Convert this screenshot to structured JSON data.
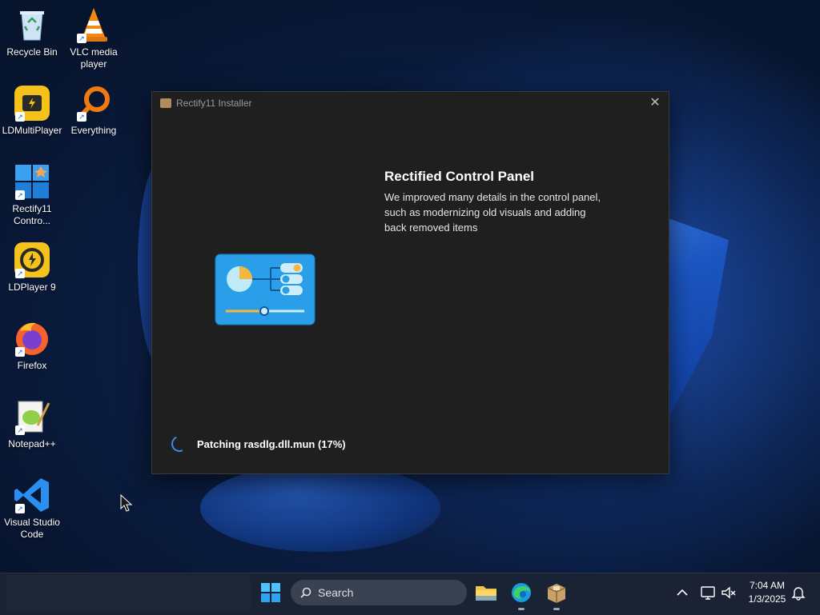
{
  "desktop": {
    "icons": [
      {
        "label": "Recycle Bin",
        "icon": "recycle-bin-icon"
      },
      {
        "label": "VLC media player",
        "icon": "vlc-icon"
      },
      {
        "label": "LDMultiPlayer",
        "icon": "ldmultiplayer-icon"
      },
      {
        "label": "Everything",
        "icon": "everything-icon"
      },
      {
        "label": "Rectify11 Contro...",
        "icon": "rectify11-icon"
      },
      {
        "label": "LDPlayer 9",
        "icon": "ldplayer-icon"
      },
      {
        "label": "Firefox",
        "icon": "firefox-icon"
      },
      {
        "label": "Notepad++",
        "icon": "notepadpp-icon"
      },
      {
        "label": "Visual Studio Code",
        "icon": "vscode-icon"
      }
    ]
  },
  "installer": {
    "title": "Rectify11 Installer",
    "close_glyph": "✕",
    "feature_title": "Rectified Control Panel",
    "feature_description": "We improved many details in the control panel, such as modernizing old visuals and adding back removed items",
    "status": "Patching rasdlg.dll.mun (17%)"
  },
  "taskbar": {
    "search_label": "Search",
    "time": "7:04 AM",
    "date": "1/3/2025",
    "tray_chevron": "^",
    "colors": {
      "accent": "#3a8de8",
      "taskbar": "#1c2434"
    }
  }
}
